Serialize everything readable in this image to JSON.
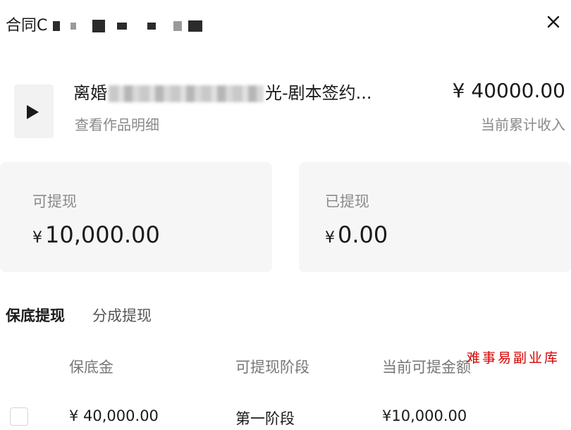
{
  "dialog": {
    "title_prefix": "合同C",
    "close_icon": "close-icon"
  },
  "work": {
    "play_icon": "play-icon",
    "title_start": "离婚",
    "title_end": "光-剧本签约...",
    "detail_link": "查看作品明细",
    "income_amount": "¥ 40000.00",
    "income_label": "当前累计收入"
  },
  "balances": {
    "withdrawable": {
      "label": "可提现",
      "currency": "¥",
      "amount": "10,000.00"
    },
    "withdrawn": {
      "label": "已提现",
      "currency": "¥",
      "amount": "0.00"
    }
  },
  "tabs": [
    {
      "label": "保底提现",
      "active": true
    },
    {
      "label": "分成提现",
      "active": false
    }
  ],
  "table": {
    "headers": [
      "保底金",
      "可提现阶段",
      "当前可提金额"
    ],
    "rows": [
      {
        "guarantee": "¥ 40,000.00",
        "stage": "第一阶段",
        "amount": "¥10,000.00"
      }
    ]
  },
  "watermark": "难事易副业库",
  "colors": {
    "card_bg": "#f6f6f7",
    "muted_text": "#8a8a8a",
    "watermark": "#d60000"
  }
}
